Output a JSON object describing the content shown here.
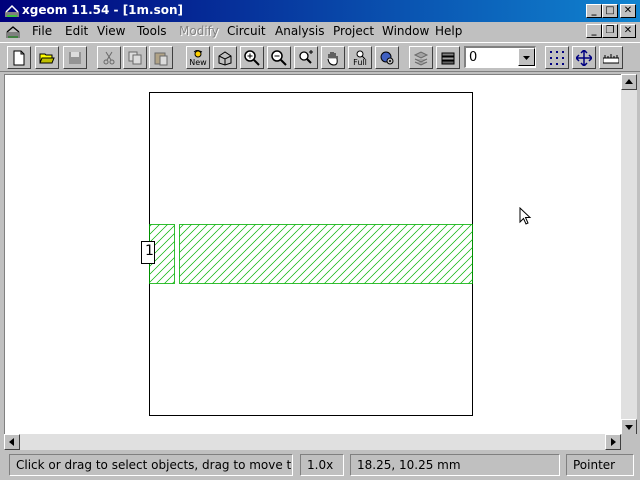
{
  "window": {
    "title": "xgeom 11.54 - [1m.son]",
    "caption_buttons": [
      "minimize-icon",
      "maximize-icon",
      "close-icon"
    ]
  },
  "menu": {
    "items": [
      {
        "label": "File",
        "enabled": true
      },
      {
        "label": "Edit",
        "enabled": true
      },
      {
        "label": "View",
        "enabled": true
      },
      {
        "label": "Tools",
        "enabled": true
      },
      {
        "label": "Modify",
        "enabled": false
      },
      {
        "label": "Circuit",
        "enabled": true
      },
      {
        "label": "Analysis",
        "enabled": true
      },
      {
        "label": "Project",
        "enabled": true
      },
      {
        "label": "Window",
        "enabled": true
      },
      {
        "label": "Help",
        "enabled": true
      }
    ]
  },
  "toolbar": {
    "new_label": "New",
    "full_label": "Full",
    "level_value": "0",
    "icons": [
      "new-file-icon",
      "open-folder-icon",
      "save-icon",
      "cut-icon",
      "copy-icon",
      "paste-icon",
      "new-project-icon",
      "3d-view-icon",
      "zoom-in-icon",
      "zoom-out-icon",
      "zoom-box-icon",
      "pan-hand-icon",
      "zoom-full-icon",
      "analyze-icon",
      "layers-icon",
      "stack-icon",
      "grid-icon",
      "move-icon",
      "ruler-icon"
    ]
  },
  "drawing": {
    "port_label": "1",
    "metal_color": "#00b000",
    "box_color": "#000000"
  },
  "status": {
    "message": "Click or drag to select objects, drag to move them",
    "zoom": "1.0x",
    "coords": "18.25, 10.25 mm",
    "mode": "Pointer"
  }
}
